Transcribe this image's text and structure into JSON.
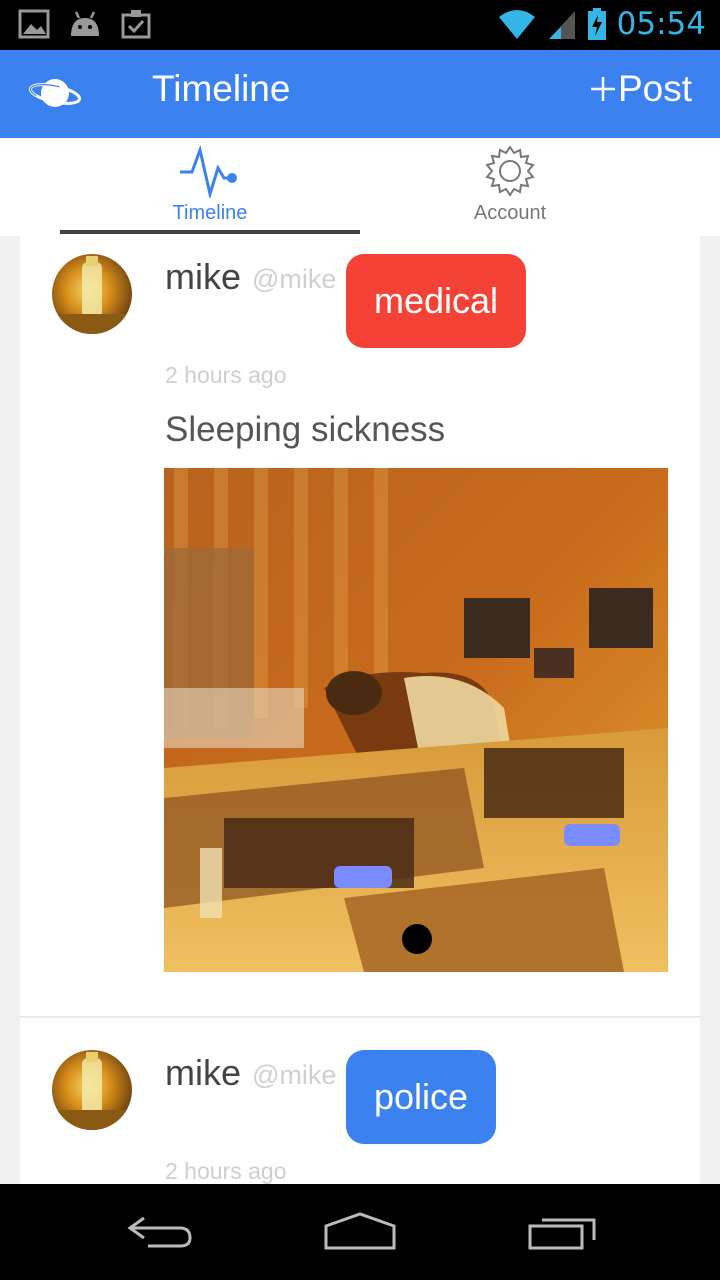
{
  "status_bar": {
    "time": "05:54"
  },
  "app_bar": {
    "title": "Timeline",
    "post_label": "Post"
  },
  "tabs": [
    {
      "label": "Timeline",
      "icon": "pulse-icon",
      "active": true
    },
    {
      "label": "Account",
      "icon": "gear-icon",
      "active": false
    }
  ],
  "posts": [
    {
      "username": "mike",
      "handle": "@mike",
      "tag": "medical",
      "tag_color": "#f44336",
      "time": "2 hours ago",
      "text": "Sleeping sickness"
    },
    {
      "username": "mike",
      "handle": "@mike",
      "tag": "police",
      "tag_color": "#3b82f0",
      "time": "2 hours ago"
    }
  ],
  "colors": {
    "primary": "#3b82f0",
    "status_accent": "#33b5e5"
  }
}
